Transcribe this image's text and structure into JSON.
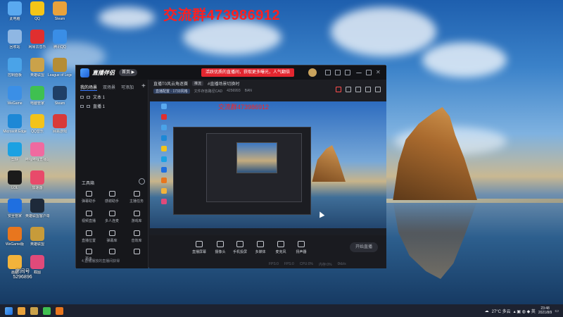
{
  "watermark": "交流群473986912",
  "desktop_icons": [
    {
      "label": "此电脑",
      "color": "#5aa9f0"
    },
    {
      "label": "QQ",
      "color": "#f5c518"
    },
    {
      "label": "Steam",
      "color": "#e9a23b"
    },
    {
      "label": "回收站",
      "color": "#8fb7e3"
    },
    {
      "label": "网易云音乐",
      "color": "#e02f2f"
    },
    {
      "label": "腾讯QQ",
      "color": "#3a8ee6"
    },
    {
      "label": "控制面板",
      "color": "#4aa3e8"
    },
    {
      "label": "英雄联盟",
      "color": "#caa24a"
    },
    {
      "label": "League of Legends",
      "color": "#b58d36"
    },
    {
      "label": "WeGame",
      "color": "#3b8fe6"
    },
    {
      "label": "电脑管家",
      "color": "#3fc050"
    },
    {
      "label": "Steam",
      "color": "#1f3f66"
    },
    {
      "label": "Microsoft Edge",
      "color": "#1d88d6"
    },
    {
      "label": "QQ音乐",
      "color": "#f3c31a"
    },
    {
      "label": "网易游戏",
      "color": "#d83a3a"
    },
    {
      "label": "剪映",
      "color": "#1ba1e2"
    },
    {
      "label": "哔哩哔哩直播姬",
      "color": "#f06aa0"
    },
    {
      "label": "LOL",
      "color": "#1b1b1b"
    },
    {
      "label": "加速器",
      "color": "#e84a6a"
    },
    {
      "label": "安全管家",
      "color": "#1f6fe0"
    },
    {
      "label": "英雄联盟客户端",
      "color": "#1e2a3a"
    },
    {
      "label": "WeGame版",
      "color": "#e8761e"
    },
    {
      "label": "英雄联盟",
      "color": "#c79b3a"
    },
    {
      "label": "画图",
      "color": "#f2b33b"
    },
    {
      "label": "截图",
      "color": "#e04a7a"
    }
  ],
  "overlay_text": {
    "line1": "房间号",
    "line2": "5296896"
  },
  "app": {
    "name": "直播伴侣",
    "version_badge": "首页 ▶",
    "promo": "活跃优质的直播间，获取更多曝光，人气翻倍",
    "side_tabs": [
      "我的场景",
      "双场景",
      "可添加"
    ],
    "add_scene": "+",
    "scenes": [
      "文本 1",
      "直播 1"
    ],
    "toolbox_title": "工具箱",
    "tools": [
      {
        "label": "弹幕助手"
      },
      {
        "label": "感谢助手"
      },
      {
        "label": "主播任务"
      },
      {
        "label": "视频直播"
      },
      {
        "label": "多人连麦"
      },
      {
        "label": "游戏库"
      },
      {
        "label": "直播位置"
      },
      {
        "label": "弹幕库"
      },
      {
        "label": "音效库"
      },
      {
        "label": "更多"
      },
      {
        "label": ""
      },
      {
        "label": ""
      }
    ],
    "status": "4,首播播放的直播间获得",
    "main_tabs": [
      "直播T0风云角逐赛",
      "推流",
      "#直播场景切换时"
    ],
    "info_row": [
      "直播配置 · 1733风格",
      "文件存放路径CAD",
      "4256993",
      "BAN"
    ],
    "preview_watermark": "交流群473986912",
    "controls": [
      {
        "label": "直播屏幕"
      },
      {
        "label": "摄像头"
      },
      {
        "label": "手机投屏"
      },
      {
        "label": "多媒体"
      },
      {
        "label": "麦克风"
      },
      {
        "label": "扬声器"
      }
    ],
    "start_btn": "开始直播",
    "status_right": [
      "FPS:0",
      "FPS:0",
      "CPU:0%",
      "内存:0%",
      "0kb/s"
    ]
  },
  "taskbar": {
    "weather": "27°C 多云",
    "time": "23:48",
    "date": "2021/8/9"
  }
}
